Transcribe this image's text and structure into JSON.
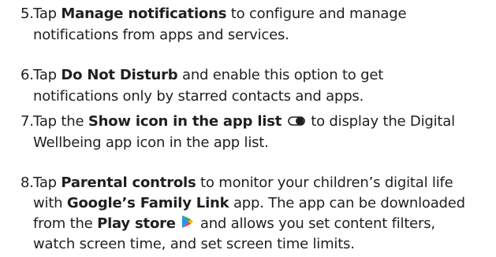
{
  "steps": [
    {
      "num": "5.",
      "tap": "Tap ",
      "bold": "Manage notifications",
      "rest1": " to configure and manage",
      "line2": "notifications from apps and services."
    },
    {
      "num": "6.",
      "tap": "Tap ",
      "bold": "Do Not Disturb",
      "rest1": " and enable this option to get",
      "line2": "notifications only by starred contacts and apps."
    },
    {
      "num": "7.",
      "tap": "Tap the ",
      "bold": "Show icon in the app list",
      "rest1": " to display the Digital",
      "line2": "Wellbeing app icon in the app list.",
      "icon": "toggle-switch-icon"
    },
    {
      "num": "8.",
      "tap": "Tap ",
      "bold": "Parental controls",
      "rest1": " to monitor your children’s digital life",
      "line2_pre": "with ",
      "line2_bold": "Google’s Family Link",
      "line2_post": " app. The app can be downloaded",
      "line3_pre": "from the ",
      "line3_bold": "Play store",
      "line3_post": " and allows you set content filters,",
      "line4": "watch screen time, and set screen time limits.",
      "icon": "play-store-icon"
    }
  ]
}
